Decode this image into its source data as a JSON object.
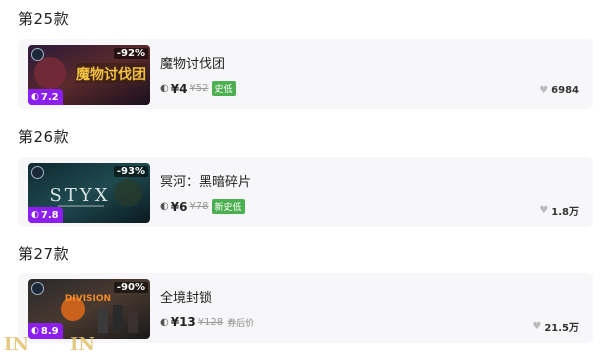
{
  "sections": [
    {
      "title": "第25款",
      "game": {
        "name": "魔物讨伐团",
        "discount": "-92%",
        "score": "7.2",
        "price": "¥4",
        "original_price": "¥52",
        "tag": "史低",
        "likes": "6984",
        "thumb_text": "魔物讨伐团"
      }
    },
    {
      "title": "第26款",
      "game": {
        "name": "冥河：黑暗碎片",
        "discount": "-93%",
        "score": "7.8",
        "price": "¥6",
        "original_price": "¥78",
        "tag": "新史低",
        "likes": "1.8万",
        "thumb_text": "STYX"
      }
    },
    {
      "title": "第27款",
      "game": {
        "name": "全境封锁",
        "discount": "-90%",
        "score": "8.9",
        "price": "¥13",
        "original_price": "¥128",
        "tag": "券后价",
        "likes": "21.5万",
        "thumb_text": "DIVISION"
      }
    }
  ],
  "watermark": "IN",
  "colors": {
    "score_bg": "#8c1ff0",
    "tag_green": "#4caf50",
    "card_bg": "#f7f7f9"
  }
}
